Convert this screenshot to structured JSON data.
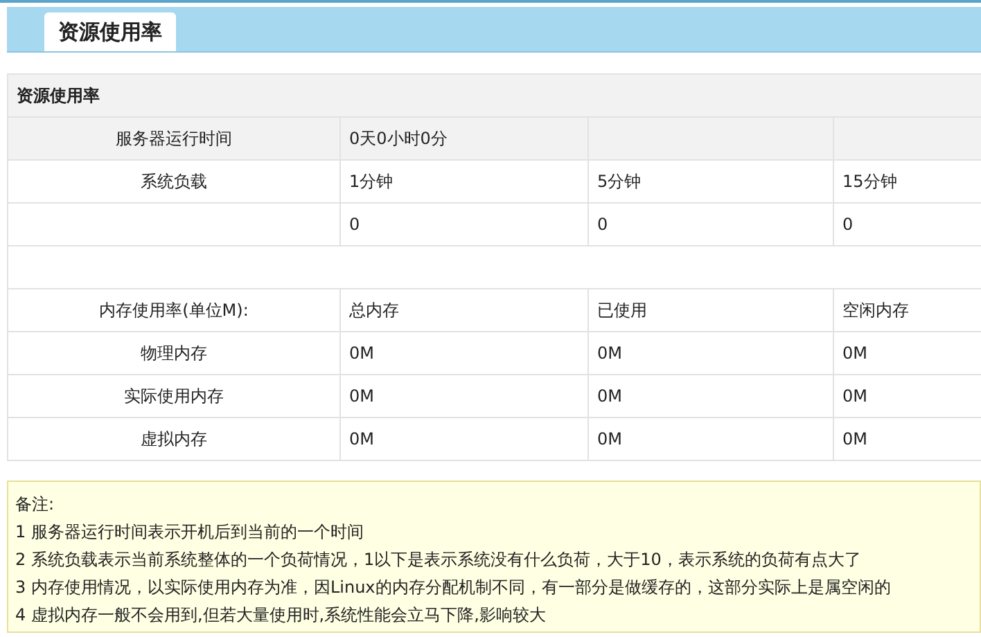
{
  "tabs": [
    {
      "label": "资源使用率",
      "selected": true
    }
  ],
  "panel": {
    "title": "资源使用率",
    "rows": [
      {
        "shaded": true,
        "cells": [
          "服务器运行时间",
          "0天0小时0分",
          "",
          ""
        ]
      },
      {
        "shaded": false,
        "cells": [
          "系统负载",
          "1分钟",
          "5分钟",
          "15分钟"
        ]
      },
      {
        "shaded": false,
        "cells": [
          "",
          "0",
          "0",
          "0"
        ]
      },
      {
        "shaded": false,
        "cells": []
      },
      {
        "shaded": false,
        "cells": [
          "内存使用率(单位M):",
          "总内存",
          "已使用",
          "空闲内存"
        ]
      },
      {
        "shaded": false,
        "cells": [
          "物理内存",
          "0M",
          "0M",
          "0M"
        ]
      },
      {
        "shaded": false,
        "cells": [
          "实际使用内存",
          "0M",
          "0M",
          "0M"
        ]
      },
      {
        "shaded": false,
        "cells": [
          "虚拟内存",
          "0M",
          "0M",
          "0M"
        ]
      }
    ]
  },
  "notes": {
    "title": "备注:",
    "lines": [
      "1 服务器运行时间表示开机后到当前的一个时间",
      "2 系统负载表示当前系统整体的一个负荷情况，1以下是表示系统没有什么负荷，大于10，表示系统的负荷有点大了",
      "3 内存使用情况，以实际使用内存为准，因Linux的内存分配机制不同，有一部分是做缓存的，这部分实际上是属空闲的",
      "4 虚拟内存一般不会用到,但若大量使用时,系统性能会立马下降,影响较大"
    ]
  }
}
